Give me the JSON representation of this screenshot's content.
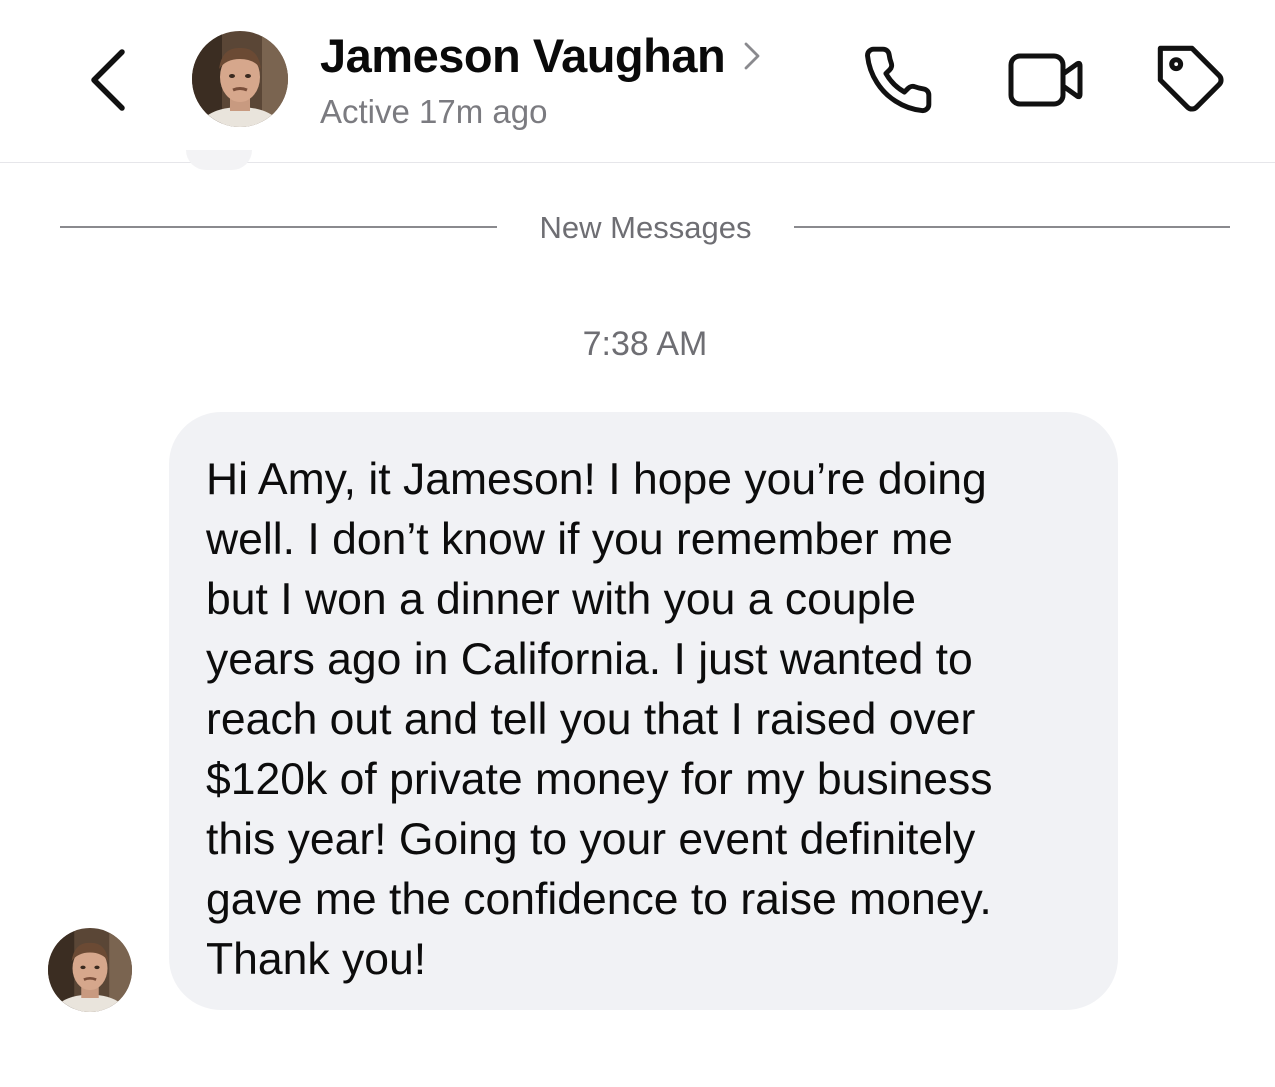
{
  "header": {
    "back_icon": "chevron-left-icon",
    "contact_name": "Jameson Vaughan",
    "contact_name_chevron": "chevron-right-icon",
    "status": "Active 17m ago",
    "actions": {
      "phone_icon": "phone-icon",
      "video_icon": "video-camera-icon",
      "tag_icon": "tag-icon"
    }
  },
  "thread": {
    "divider_label": "New Messages",
    "timestamp": "7:38 AM",
    "messages": [
      {
        "sender": "Jameson Vaughan",
        "text": "Hi Amy, it Jameson! I hope you’re doing\nwell. I don’t know if you remember me\nbut I won a dinner with you a couple\nyears ago in California. I just wanted to\nreach out and tell you that I raised over\n$120k of private money for my business\nthis year! Going to your event definitely\ngave me the confidence to raise money.\nThank you!"
      }
    ]
  },
  "colors": {
    "bubble_bg": "#f1f2f5",
    "secondary_text": "#6e6e73",
    "divider": "#8a8a8e"
  }
}
